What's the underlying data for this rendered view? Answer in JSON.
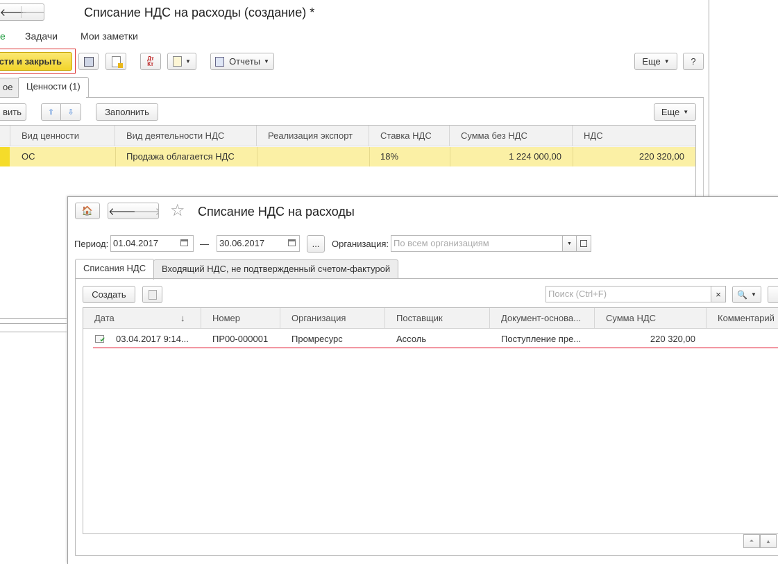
{
  "bg_window": {
    "title": "Списание НДС на расходы (создание) *",
    "nav_tabs": [
      "е",
      "Задачи",
      "Мои заметки"
    ],
    "toolbar": {
      "post_close_label": "сти и закрыть",
      "reports_label": "Отчеты",
      "more_label": "Еще",
      "help_label": "?"
    },
    "tabs": [
      "ое",
      "Ценности (1)"
    ],
    "table_toolbar": {
      "add_label": "вить",
      "fill_label": "Заполнить",
      "more_label": "Еще"
    },
    "table": {
      "columns": [
        "Вид ценности",
        "Вид деятельности НДС",
        "Реализация экспорт",
        "Ставка НДС",
        "Сумма без НДС",
        "НДС"
      ],
      "rows": [
        [
          "ОС",
          "Продажа облагается НДС",
          "",
          "18%",
          "1 224 000,00",
          "220 320,00"
        ]
      ]
    }
  },
  "fg_window": {
    "title": "Списание НДС на расходы",
    "period_label": "Период:",
    "date_from": "01.04.2017",
    "dash": "—",
    "date_to": "30.06.2017",
    "ellipsis": "...",
    "org_label": "Организация:",
    "org_placeholder": "По всем организациям",
    "tabs": [
      "Списания НДС",
      "Входящий НДС, не подтвержденный счетом-фактурой"
    ],
    "create_label": "Создать",
    "search_placeholder": "Поиск (Ctrl+F)",
    "clear_label": "×",
    "sort_arrow": "↓",
    "table": {
      "columns": [
        "Дата",
        "Номер",
        "Организация",
        "Поставщик",
        "Документ-основа...",
        "Сумма НДС",
        "Комментарий"
      ],
      "rows": [
        [
          "03.04.2017 9:14...",
          "ПР00-000001",
          "Промресурс",
          "Ассоль",
          "Поступление пре...",
          "220 320,00",
          ""
        ]
      ]
    }
  },
  "colors": {
    "highlight_row": "#fbf0a5",
    "accent_yellow": "#f5dc2a",
    "selection_line": "#e0001b"
  }
}
